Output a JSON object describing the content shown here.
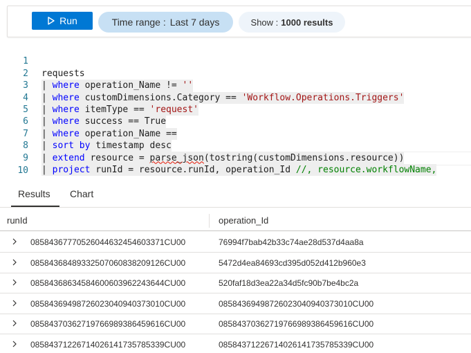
{
  "toolbar": {
    "run_label": "Run",
    "time_range_label": "Time range :",
    "time_range_value": "Last 7 days",
    "show_label": "Show :",
    "show_value": "1000 results"
  },
  "editor": {
    "lines": [
      {
        "num": "1"
      },
      {
        "num": "2"
      },
      {
        "num": "3"
      },
      {
        "num": "4"
      },
      {
        "num": "5"
      },
      {
        "num": "6"
      },
      {
        "num": "7"
      },
      {
        "num": "8"
      },
      {
        "num": "9"
      },
      {
        "num": "10"
      }
    ],
    "tokens": {
      "l1": "requests",
      "pipe": "| ",
      "where": "where",
      "sort": "sort by",
      "extend": "extend",
      "project": "project",
      "l2_a": " operation_Name != ",
      "l2_s": "''",
      "l3_a": " customDimensions.Category == ",
      "l3_s": "'Workflow.Operations.Triggers'",
      "l4_a": " itemType == ",
      "l4_s": "'request'",
      "l5_a": " success == True",
      "l6_a": " operation_Name ==",
      "l7_a": " timestamp desc",
      "l8_a": " resource = ",
      "l8_sq": "parse_json",
      "l8_b": "(tostring(customDimensions.resource))",
      "l9_a": " runId = resource.runId, operation_Id ",
      "l9_c": "//, resource.workflowName,"
    }
  },
  "results": {
    "tabs": [
      {
        "label": "Results",
        "active": true
      },
      {
        "label": "Chart",
        "active": false
      }
    ],
    "columns": [
      "runId",
      "operation_Id"
    ],
    "rows": [
      {
        "runId": "08584367770526044632454603371CU00",
        "operation_Id": "76994f7bab42b33c74ae28d537d4aa8a"
      },
      {
        "runId": "08584368489332507060838209126CU00",
        "operation_Id": "5472d4ea84693cd395d052d412b960e3"
      },
      {
        "runId": "08584368634584600603962243644CU00",
        "operation_Id": "520faf18d3ea22a34d5fc90b7be4bc2a"
      },
      {
        "runId": "08584369498726023040940373010CU00",
        "operation_Id": "08584369498726023040940373010CU00"
      },
      {
        "runId": "08584370362719766989386459616CU00",
        "operation_Id": "08584370362719766989386459616CU00"
      },
      {
        "runId": "08584371226714026141735785339CU00",
        "operation_Id": "08584371226714026141735785339CU00"
      }
    ]
  },
  "colors": {
    "accent": "#0078d4",
    "time_pill": "#c7e0f4",
    "keyword": "#0000ff",
    "string": "#a31515",
    "comment": "#008000",
    "line_number": "#237893"
  }
}
